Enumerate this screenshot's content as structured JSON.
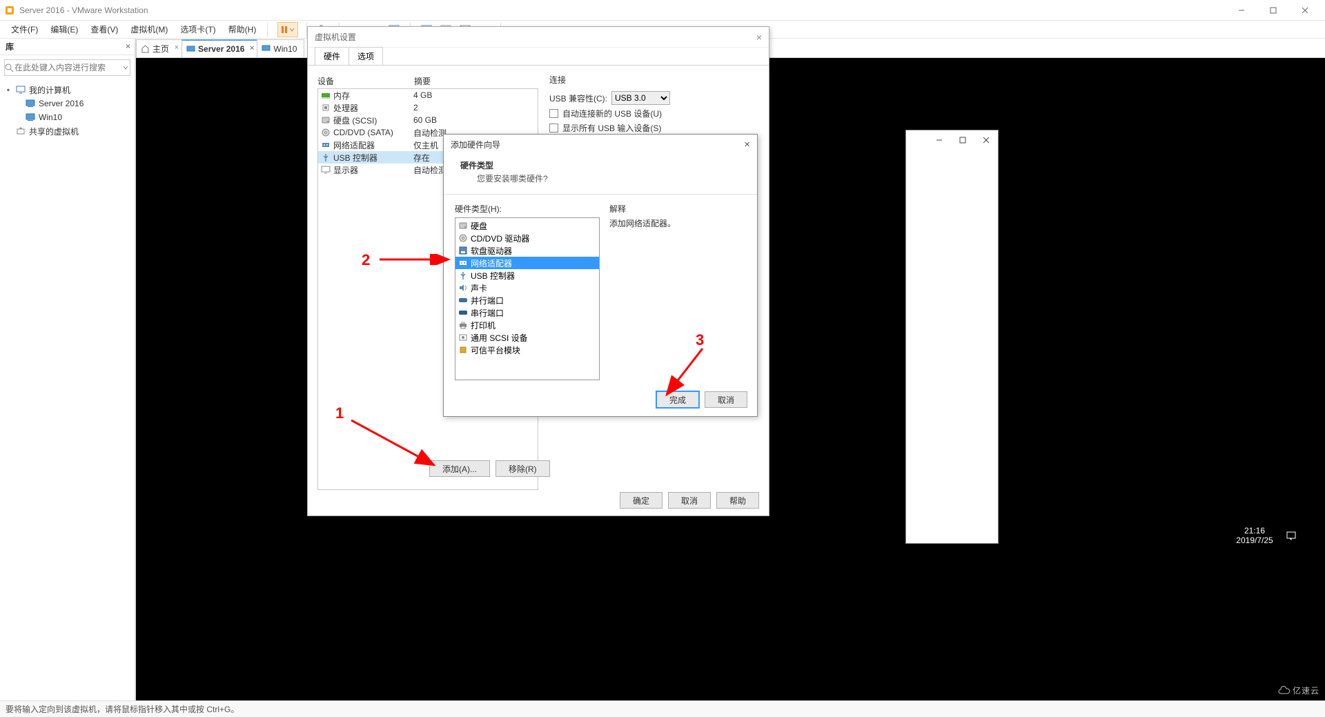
{
  "window": {
    "title": "Server 2016 - VMware Workstation"
  },
  "menu": {
    "file": "文件(F)",
    "edit": "编辑(E)",
    "view": "查看(V)",
    "vm": "虚拟机(M)",
    "tabs": "选项卡(T)",
    "help": "帮助(H)"
  },
  "sidebar": {
    "title": "库",
    "search_placeholder": "在此处键入内容进行搜索",
    "root": "我的计算机",
    "items": [
      "Server 2016",
      "Win10"
    ],
    "shared": "共享的虚拟机"
  },
  "tabs": {
    "home": "主页",
    "server": "Server 2016",
    "win10": "Win10"
  },
  "settings": {
    "title": "虚拟机设置",
    "tab_hardware": "硬件",
    "tab_options": "选项",
    "col_device": "设备",
    "col_summary": "摘要",
    "rows": [
      {
        "label": "内存",
        "summary": "4 GB",
        "icon": "memory-icon"
      },
      {
        "label": "处理器",
        "summary": "2",
        "icon": "cpu-icon"
      },
      {
        "label": "硬盘 (SCSI)",
        "summary": "60 GB",
        "icon": "disk-icon"
      },
      {
        "label": "CD/DVD (SATA)",
        "summary": "自动检测",
        "icon": "cd-icon"
      },
      {
        "label": "网络适配器",
        "summary": "仅主机",
        "icon": "net-icon"
      },
      {
        "label": "USB 控制器",
        "summary": "存在",
        "icon": "usb-icon",
        "selected": true
      },
      {
        "label": "显示器",
        "summary": "自动检测",
        "icon": "display-icon"
      }
    ],
    "right": {
      "section": "连接",
      "usb_compat_label": "USB 兼容性(C):",
      "usb_compat_value": "USB 3.0",
      "auto_connect": "自动连接新的 USB 设备(U)",
      "show_all": "显示所有 USB 输入设备(S)"
    },
    "buttons": {
      "add": "添加(A)...",
      "remove": "移除(R)",
      "ok": "确定",
      "cancel": "取消",
      "help": "帮助"
    }
  },
  "wizard": {
    "title": "添加硬件向导",
    "header_title": "硬件类型",
    "header_sub": "您要安装哪类硬件?",
    "list_label": "硬件类型(H):",
    "items": [
      {
        "label": "硬盘",
        "icon": "disk-icon"
      },
      {
        "label": "CD/DVD 驱动器",
        "icon": "cd-icon"
      },
      {
        "label": "软盘驱动器",
        "icon": "floppy-icon"
      },
      {
        "label": "网络适配器",
        "icon": "net-icon",
        "selected": true
      },
      {
        "label": "USB 控制器",
        "icon": "usb-icon"
      },
      {
        "label": "声卡",
        "icon": "sound-icon"
      },
      {
        "label": "并行端口",
        "icon": "parallel-icon"
      },
      {
        "label": "串行端口",
        "icon": "serial-icon"
      },
      {
        "label": "打印机",
        "icon": "printer-icon"
      },
      {
        "label": "通用 SCSI 设备",
        "icon": "scsi-icon"
      },
      {
        "label": "可信平台模块",
        "icon": "tpm-icon"
      }
    ],
    "explain_label": "解释",
    "explain_text": "添加网络适配器。",
    "finish": "完成",
    "cancel": "取消"
  },
  "annotations": {
    "one": "1",
    "two": "2",
    "three": "3"
  },
  "statusbar": {
    "text": "要将输入定向到该虚拟机，请将鼠标指针移入其中或按 Ctrl+G。"
  },
  "clock": {
    "time": "21:16",
    "date": "2019/7/25"
  },
  "watermark": "亿速云"
}
